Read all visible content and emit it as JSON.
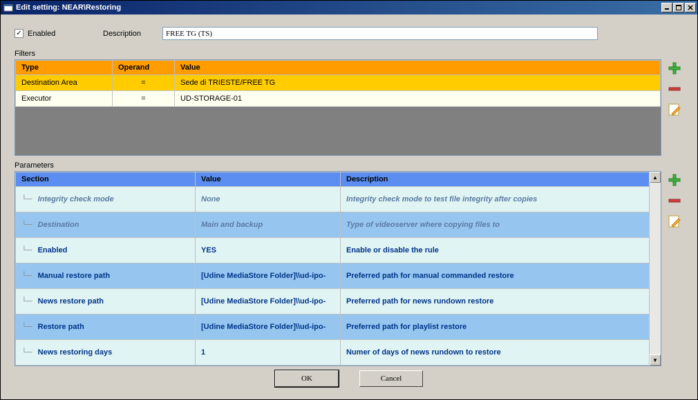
{
  "window": {
    "title": "Edit setting: NEAR\\Restoring"
  },
  "header": {
    "enabled_label": "Enabled",
    "enabled_checked": true,
    "description_label": "Description",
    "description_value": "FREE TG (TS)"
  },
  "filters": {
    "label": "Filters",
    "columns": {
      "type": "Type",
      "operand": "Operand",
      "value": "Value"
    },
    "rows": [
      {
        "type": "Destination Area",
        "operand": "=",
        "value": "Sede di TRIESTE/FREE TG",
        "highlight": true
      },
      {
        "type": "Executor",
        "operand": "=",
        "value": "UD-STORAGE-01",
        "highlight": false
      }
    ]
  },
  "parameters": {
    "label": "Parameters",
    "columns": {
      "section": "Section",
      "value": "Value",
      "description": "Description"
    },
    "rows": [
      {
        "section": "Integrity check mode",
        "value": "None",
        "description": "Integrity check mode to test file integrity after copies",
        "italic": true
      },
      {
        "section": "Destination",
        "value": "Main and backup",
        "description": "Type of videoserver where copying files to",
        "italic": true
      },
      {
        "section": "Enabled",
        "value": "YES",
        "description": "Enable or disable the rule",
        "italic": false
      },
      {
        "section": "Manual restore path",
        "value": "[Udine MediaStore Folder]\\\\ud-ipo-",
        "description": "Preferred path for manual commanded restore",
        "italic": false
      },
      {
        "section": "News restore path",
        "value": "[Udine MediaStore Folder]\\\\ud-ipo-",
        "description": "Preferred path for news rundown restore",
        "italic": false
      },
      {
        "section": "Restore path",
        "value": "[Udine MediaStore Folder]\\\\ud-ipo-",
        "description": "Preferred path for playlist restore",
        "italic": false
      },
      {
        "section": "News restoring days",
        "value": "1",
        "description": "Numer of days of news rundown to restore",
        "italic": false
      }
    ]
  },
  "buttons": {
    "ok": "OK",
    "cancel": "Cancel"
  }
}
